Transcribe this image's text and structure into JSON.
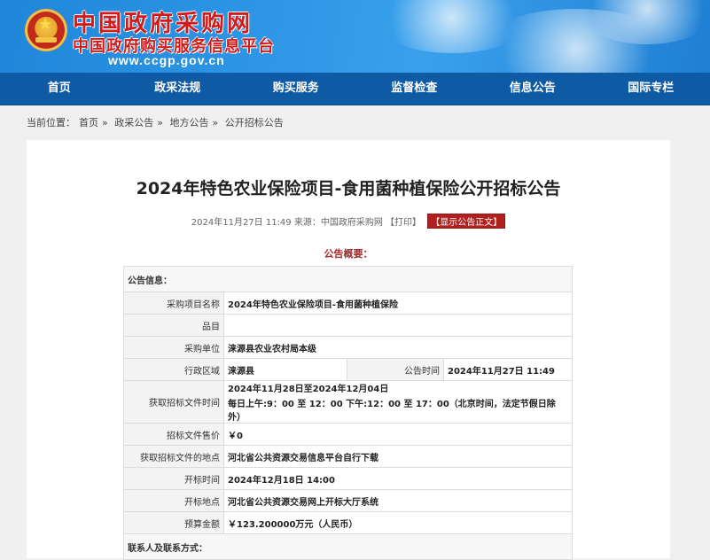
{
  "header": {
    "title_cn": "中国政府采购网",
    "subtitle_cn": "中国政府购买服务信息平台",
    "url": "www.ccgp.gov.cn"
  },
  "nav": {
    "items": [
      "首页",
      "政采法规",
      "购买服务",
      "监督检查",
      "信息公告",
      "国际专栏"
    ]
  },
  "breadcrumb": {
    "prefix": "当前位置：",
    "items": [
      "首页",
      "政采公告",
      "地方公告",
      "公开招标公告"
    ],
    "separator": "»"
  },
  "article": {
    "title": "2024年特色农业保险项目-食用菌种植保险公开招标公告",
    "meta_text": "2024年11月27日 11:49 来源：中国政府采购网",
    "print_label": "【打印】",
    "show_full_label": "【显示公告正文】",
    "summary_heading": "公告概要："
  },
  "info": {
    "section_announce": "公告信息：",
    "project_name_label": "采购项目名称",
    "project_name_value": "2024年特色农业保险项目-食用菌种植保险",
    "item_label": "品目",
    "item_value": "",
    "purchaser_label": "采购单位",
    "purchaser_value": "涞源县农业农村局本级",
    "region_label": "行政区域",
    "region_value": "涞源县",
    "announce_time_label": "公告时间",
    "announce_time_value": "2024年11月27日 11:49",
    "fetch_time_label": "获取招标文件时间",
    "fetch_time_line1": "2024年11月28日至2024年12月04日",
    "fetch_time_line2": "每日上午:9：00 至 12：00  下午:12：00 至 17：00（北京时间，法定节假日除外）",
    "price_label": "招标文件售价",
    "price_value": "￥0",
    "fetch_place_label": "获取招标文件的地点",
    "fetch_place_value": "河北省公共资源交易信息平台自行下载",
    "open_time_label": "开标时间",
    "open_time_value": "2024年12月18日 14:00",
    "open_place_label": "开标地点",
    "open_place_value": "河北省公共资源交易网上开标大厅系统",
    "budget_label": "预算金额",
    "budget_value": "￥123.200000万元（人民币）",
    "section_contact": "联系人及联系方式："
  },
  "colors": {
    "header_blue": "#1f86d9",
    "nav_blue": "#0f5aa5",
    "accent_red": "#a52a2a"
  }
}
